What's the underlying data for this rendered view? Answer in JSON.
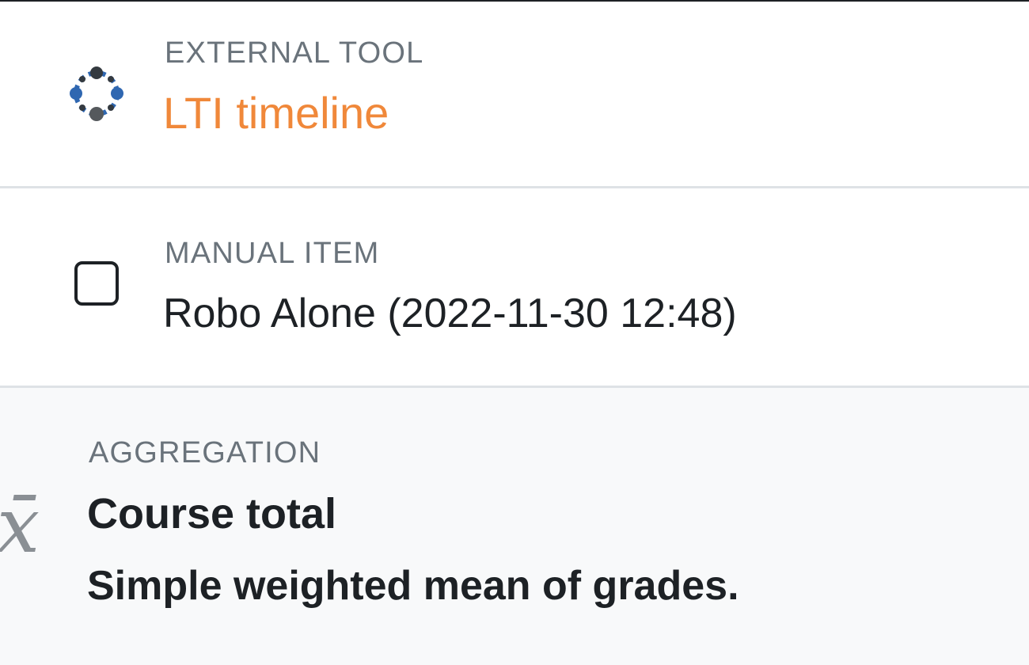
{
  "items": {
    "external_tool": {
      "type_label": "EXTERNAL TOOL",
      "title": "LTI timeline",
      "icon": "lti-tool-icon",
      "title_color": "#f0883a"
    },
    "manual_item": {
      "type_label": "MANUAL ITEM",
      "title": "Robo Alone (2022-11-30 12:48)",
      "icon": "manual-item-checkbox-icon"
    },
    "aggregation": {
      "type_label": "AGGREGATION",
      "title": "Course total",
      "description": "Simple weighted mean of grades.",
      "icon": "aggregation-xbar-icon",
      "icon_glyph": "x̄"
    }
  },
  "colors": {
    "accent": "#f0883a",
    "label_gray": "#6a737b",
    "text_dark": "#1d2125",
    "aggregation_bg": "#f8f9fa",
    "divider": "#dee2e6",
    "lti_blue": "#2f67b1",
    "lti_dark": "#343a40"
  }
}
